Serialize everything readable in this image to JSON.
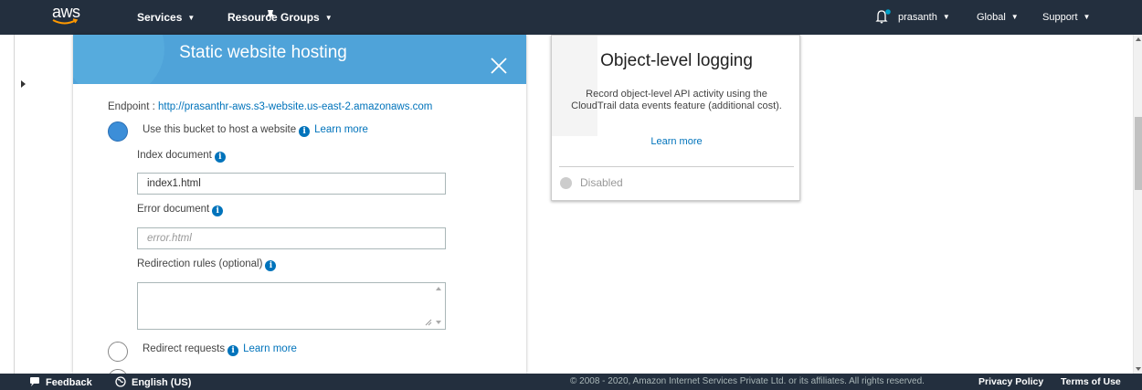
{
  "topnav": {
    "logo_text": "aws",
    "services": "Services",
    "resource_groups": "Resource Groups",
    "user": "prasanth",
    "region": "Global",
    "support": "Support"
  },
  "panel": {
    "title": "Static website hosting",
    "endpoint_label": "Endpoint : ",
    "endpoint_url": "http://prasanthr-aws.s3-website.us-east-2.amazonaws.com",
    "option_host": "Use this bucket to host a website",
    "option_redirect": "Redirect requests",
    "learn_more": "Learn more",
    "index_label": "Index document",
    "index_value": "index1.html",
    "error_label": "Error document",
    "error_placeholder": "error.html",
    "redirection_label": "Redirection rules (optional)",
    "info_glyph": "i"
  },
  "logging": {
    "title": "Object-level logging",
    "description": "Record object-level API activity using the CloudTrail data events feature (additional cost).",
    "learn_more": "Learn more",
    "status": "Disabled"
  },
  "footer": {
    "feedback": "Feedback",
    "language": "English (US)",
    "copyright": "© 2008 - 2020, Amazon Internet Services Private Ltd. or its affiliates. All rights reserved.",
    "privacy": "Privacy Policy",
    "terms": "Terms of Use"
  },
  "colors": {
    "nav_bg": "#232f3e",
    "panel_header": "#4fa3d9",
    "link": "#0073bb",
    "radio_selected": "#3c8ed8",
    "notification_dot": "#00a1c9"
  },
  "icons": [
    "aws-logo-icon",
    "pin-icon",
    "bell-icon",
    "close-icon",
    "info-icon",
    "feedback-icon",
    "globe-icon"
  ]
}
